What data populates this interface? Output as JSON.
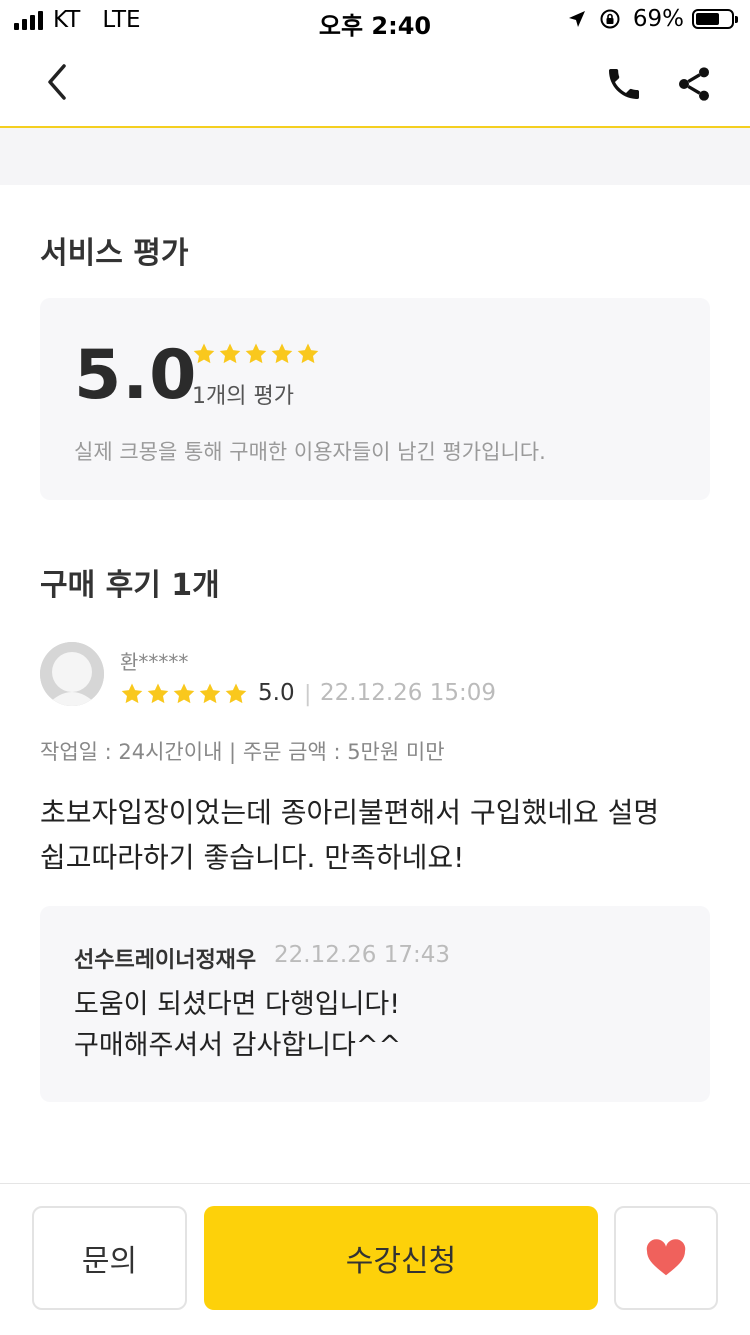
{
  "status_bar": {
    "carrier": "KT",
    "network": "LTE",
    "time": "오후 2:40",
    "battery": "69%",
    "battery_fraction": 0.69
  },
  "nav": {
    "back_icon": "chevron-left-icon",
    "call_icon": "phone-icon",
    "share_icon": "share-icon"
  },
  "service_rating": {
    "title": "서비스 평가",
    "score": "5.0",
    "stars": 5,
    "count_text": "1개의 평가",
    "note": "실제 크몽을 통해 구매한 이용자들이 남긴 평가입니다."
  },
  "reviews_section": {
    "title": "구매 후기 1개"
  },
  "review": {
    "reviewer": "환*****",
    "stars": 5,
    "score": "5.0",
    "separator": "|",
    "date": "22.12.26 15:09",
    "meta": "작업일 : 24시간이내 | 주문 금액 : 5만원 미만",
    "body_line1": "초보자입장이었는데 종아리불편해서 구입했네요 설명",
    "body_line2": "쉽고따라하기 좋습니다. 만족하네요!"
  },
  "reply": {
    "author": "선수트레이너정재우",
    "date": "22.12.26 17:43",
    "line1": "도움이 되셨다면 다행입니다!",
    "line2": "구매해주셔서 감사합니다^^"
  },
  "bottom_bar": {
    "inquiry_label": "문의",
    "enroll_label": "수강신청",
    "heart_icon": "heart-icon"
  },
  "colors": {
    "accent": "#fdd10a",
    "star": "#f9c81d",
    "heart": "#f0615c",
    "divider": "#f4cf20"
  }
}
